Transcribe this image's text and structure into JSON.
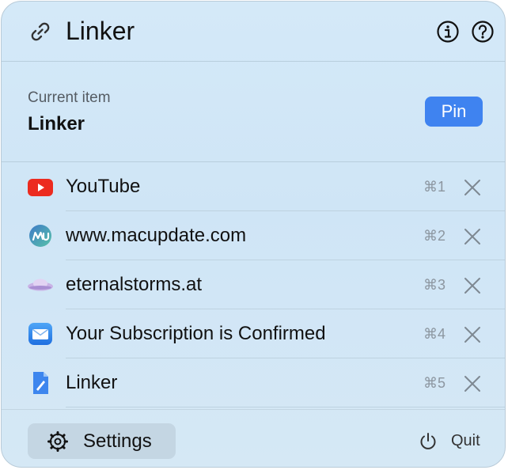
{
  "app": {
    "title": "Linker",
    "icon": "link-icon"
  },
  "header": {
    "info_icon": "info-icon",
    "help_icon": "help-icon"
  },
  "current_item": {
    "label": "Current item",
    "value": "Linker",
    "pin_label": "Pin",
    "pin_color": "#3f83f0"
  },
  "items": [
    {
      "label": "YouTube",
      "shortcut": "⌘1",
      "icon": "youtube-icon"
    },
    {
      "label": "www.macupdate.com",
      "shortcut": "⌘2",
      "icon": "macupdate-icon"
    },
    {
      "label": "eternalstorms.at",
      "shortcut": "⌘3",
      "icon": "cloud-icon"
    },
    {
      "label": "Your Subscription is Confirmed",
      "shortcut": "⌘4",
      "icon": "mail-icon"
    },
    {
      "label": "Linker",
      "shortcut": "⌘5",
      "icon": "document-icon"
    }
  ],
  "footer": {
    "settings_label": "Settings",
    "quit_label": "Quit"
  }
}
